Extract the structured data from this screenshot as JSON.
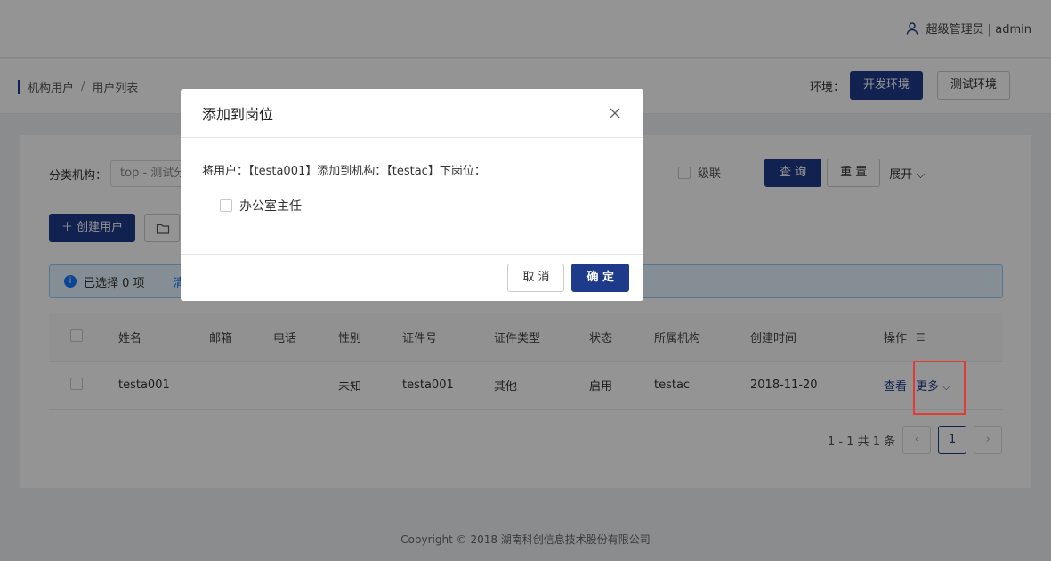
{
  "header": {
    "user": "超级管理员 | admin"
  },
  "breadcrumb": {
    "items": [
      "机构用户",
      "用户列表"
    ],
    "sep": "/"
  },
  "env": {
    "label": "环境：",
    "dev": "开发环境",
    "test": "测试环境"
  },
  "filter": {
    "org_label": "分类机构：",
    "org_value": "top - 测试分",
    "cascade": "级联",
    "query": "查 询",
    "reset": "重 置",
    "expand": "展开",
    "expand_icon": "chevron-down-icon"
  },
  "actions": {
    "create": "创建用户",
    "create_icon": "plus-icon",
    "folder_icon": "folder-icon"
  },
  "alert": {
    "text": "已选择 0 项",
    "clear": "清"
  },
  "table": {
    "headers": [
      "姓名",
      "邮箱",
      "电话",
      "性别",
      "证件号",
      "证件类型",
      "状态",
      "所属机构",
      "创建时间",
      "操作"
    ],
    "rows": [
      {
        "name": "testa001",
        "mail": "",
        "tel": "",
        "sex": "未知",
        "id": "testa001",
        "idtype": "其他",
        "status": "启用",
        "org": "testac",
        "time": "2018-11-20",
        "view": "查看",
        "more": "更多"
      }
    ]
  },
  "pager": {
    "summary": "1 - 1 共 1 条",
    "current": "1"
  },
  "footer": {
    "text": "Copyright © 2018 湖南科创信息技术股份有限公司"
  },
  "modal": {
    "title": "添加到岗位",
    "text": "将用户：【testa001】添加到机构：【testac】下岗位：",
    "option": "办公室主任",
    "cancel": "取 消",
    "ok": "确 定"
  },
  "colors": {
    "brand": "#1e3a8a",
    "highlight": "#e53935"
  }
}
